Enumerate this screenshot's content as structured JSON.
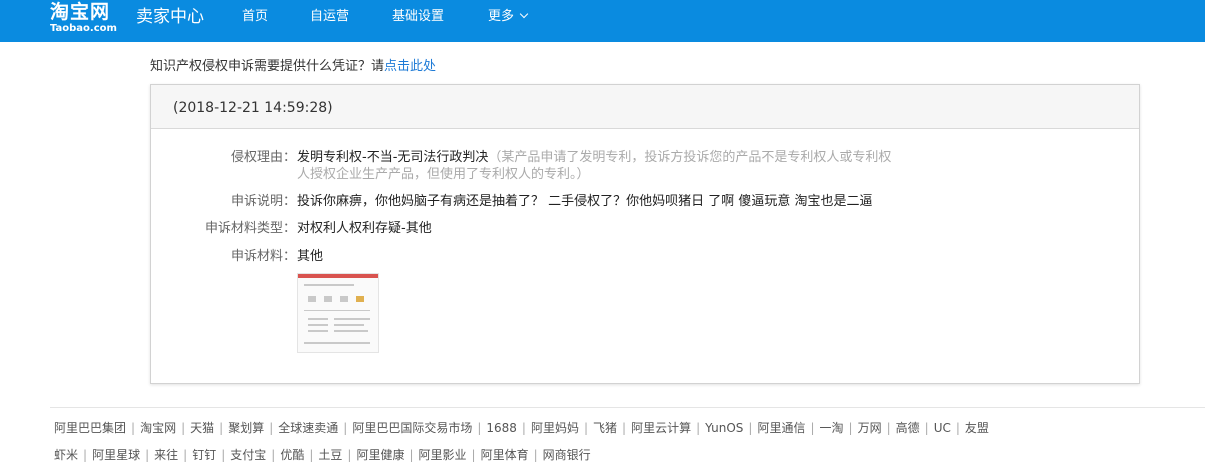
{
  "header": {
    "logo_cn": "淘宝网",
    "logo_en": "Taobao.com",
    "section_title": "卖家中心",
    "nav": [
      "首页",
      "自运营",
      "基础设置",
      "更多"
    ],
    "accent_color": "#0a8be0"
  },
  "help": {
    "prefix": "知识产权侵权申诉需要提供什么凭证？请",
    "link": "点击此处"
  },
  "record": {
    "timestamp": "(2018-12-21 14:59:28)",
    "reason_label": "侵权理由：",
    "reason_value": "发明专利权-不当-无司法行政判决",
    "reason_note_line1": "（某产品申请了发明专利，投诉方投诉您的产品不是专利权人或专利权",
    "reason_note_line2": "人授权企业生产产品，但使用了专利权人的专利。）",
    "desc_label": "申诉说明：",
    "desc_value": "投诉你麻痹，你他妈脑子有病还是抽着了？ 二手侵权了？你他妈呗猪日 了啊 傻逼玩意 淘宝也是二逼",
    "type_label": "申诉材料类型：",
    "type_value": "对权利人权利存疑-其他",
    "material_label": "申诉材料：",
    "material_value": "其他"
  },
  "footer": {
    "row1": [
      "阿里巴巴集团",
      "淘宝网",
      "天猫",
      "聚划算",
      "全球速卖通",
      "阿里巴巴国际交易市场",
      "1688",
      "阿里妈妈",
      "飞猪",
      "阿里云计算",
      "YunOS",
      "阿里通信",
      "一淘",
      "万网",
      "高德",
      "UC",
      "友盟"
    ],
    "row2": [
      "虾米",
      "阿里星球",
      "来往",
      "钉钉",
      "支付宝",
      "优酷",
      "土豆",
      "阿里健康",
      "阿里影业",
      "阿里体育",
      "网商银行"
    ]
  }
}
